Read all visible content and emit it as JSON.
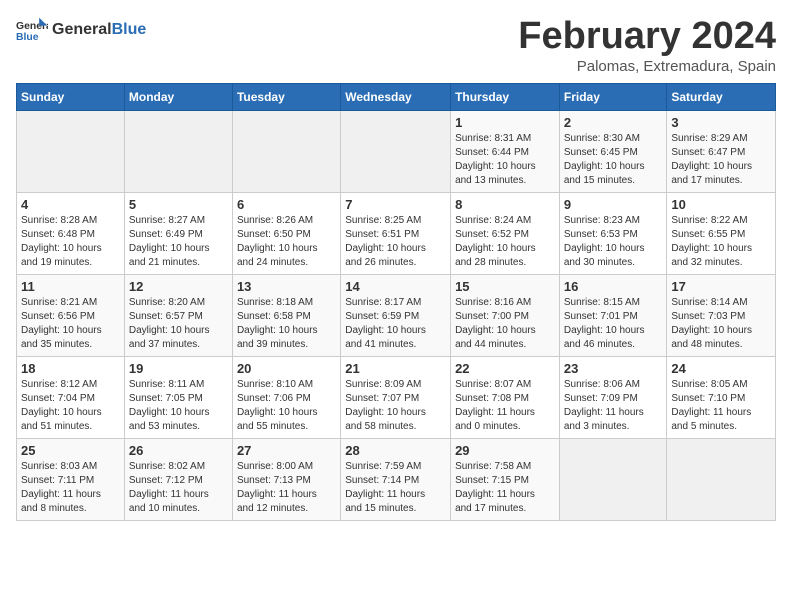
{
  "header": {
    "logo_general": "General",
    "logo_blue": "Blue",
    "month_title": "February 2024",
    "subtitle": "Palomas, Extremadura, Spain"
  },
  "days_of_week": [
    "Sunday",
    "Monday",
    "Tuesday",
    "Wednesday",
    "Thursday",
    "Friday",
    "Saturday"
  ],
  "weeks": [
    [
      {
        "num": "",
        "info": ""
      },
      {
        "num": "",
        "info": ""
      },
      {
        "num": "",
        "info": ""
      },
      {
        "num": "",
        "info": ""
      },
      {
        "num": "1",
        "info": "Sunrise: 8:31 AM\nSunset: 6:44 PM\nDaylight: 10 hours\nand 13 minutes."
      },
      {
        "num": "2",
        "info": "Sunrise: 8:30 AM\nSunset: 6:45 PM\nDaylight: 10 hours\nand 15 minutes."
      },
      {
        "num": "3",
        "info": "Sunrise: 8:29 AM\nSunset: 6:47 PM\nDaylight: 10 hours\nand 17 minutes."
      }
    ],
    [
      {
        "num": "4",
        "info": "Sunrise: 8:28 AM\nSunset: 6:48 PM\nDaylight: 10 hours\nand 19 minutes."
      },
      {
        "num": "5",
        "info": "Sunrise: 8:27 AM\nSunset: 6:49 PM\nDaylight: 10 hours\nand 21 minutes."
      },
      {
        "num": "6",
        "info": "Sunrise: 8:26 AM\nSunset: 6:50 PM\nDaylight: 10 hours\nand 24 minutes."
      },
      {
        "num": "7",
        "info": "Sunrise: 8:25 AM\nSunset: 6:51 PM\nDaylight: 10 hours\nand 26 minutes."
      },
      {
        "num": "8",
        "info": "Sunrise: 8:24 AM\nSunset: 6:52 PM\nDaylight: 10 hours\nand 28 minutes."
      },
      {
        "num": "9",
        "info": "Sunrise: 8:23 AM\nSunset: 6:53 PM\nDaylight: 10 hours\nand 30 minutes."
      },
      {
        "num": "10",
        "info": "Sunrise: 8:22 AM\nSunset: 6:55 PM\nDaylight: 10 hours\nand 32 minutes."
      }
    ],
    [
      {
        "num": "11",
        "info": "Sunrise: 8:21 AM\nSunset: 6:56 PM\nDaylight: 10 hours\nand 35 minutes."
      },
      {
        "num": "12",
        "info": "Sunrise: 8:20 AM\nSunset: 6:57 PM\nDaylight: 10 hours\nand 37 minutes."
      },
      {
        "num": "13",
        "info": "Sunrise: 8:18 AM\nSunset: 6:58 PM\nDaylight: 10 hours\nand 39 minutes."
      },
      {
        "num": "14",
        "info": "Sunrise: 8:17 AM\nSunset: 6:59 PM\nDaylight: 10 hours\nand 41 minutes."
      },
      {
        "num": "15",
        "info": "Sunrise: 8:16 AM\nSunset: 7:00 PM\nDaylight: 10 hours\nand 44 minutes."
      },
      {
        "num": "16",
        "info": "Sunrise: 8:15 AM\nSunset: 7:01 PM\nDaylight: 10 hours\nand 46 minutes."
      },
      {
        "num": "17",
        "info": "Sunrise: 8:14 AM\nSunset: 7:03 PM\nDaylight: 10 hours\nand 48 minutes."
      }
    ],
    [
      {
        "num": "18",
        "info": "Sunrise: 8:12 AM\nSunset: 7:04 PM\nDaylight: 10 hours\nand 51 minutes."
      },
      {
        "num": "19",
        "info": "Sunrise: 8:11 AM\nSunset: 7:05 PM\nDaylight: 10 hours\nand 53 minutes."
      },
      {
        "num": "20",
        "info": "Sunrise: 8:10 AM\nSunset: 7:06 PM\nDaylight: 10 hours\nand 55 minutes."
      },
      {
        "num": "21",
        "info": "Sunrise: 8:09 AM\nSunset: 7:07 PM\nDaylight: 10 hours\nand 58 minutes."
      },
      {
        "num": "22",
        "info": "Sunrise: 8:07 AM\nSunset: 7:08 PM\nDaylight: 11 hours\nand 0 minutes."
      },
      {
        "num": "23",
        "info": "Sunrise: 8:06 AM\nSunset: 7:09 PM\nDaylight: 11 hours\nand 3 minutes."
      },
      {
        "num": "24",
        "info": "Sunrise: 8:05 AM\nSunset: 7:10 PM\nDaylight: 11 hours\nand 5 minutes."
      }
    ],
    [
      {
        "num": "25",
        "info": "Sunrise: 8:03 AM\nSunset: 7:11 PM\nDaylight: 11 hours\nand 8 minutes."
      },
      {
        "num": "26",
        "info": "Sunrise: 8:02 AM\nSunset: 7:12 PM\nDaylight: 11 hours\nand 10 minutes."
      },
      {
        "num": "27",
        "info": "Sunrise: 8:00 AM\nSunset: 7:13 PM\nDaylight: 11 hours\nand 12 minutes."
      },
      {
        "num": "28",
        "info": "Sunrise: 7:59 AM\nSunset: 7:14 PM\nDaylight: 11 hours\nand 15 minutes."
      },
      {
        "num": "29",
        "info": "Sunrise: 7:58 AM\nSunset: 7:15 PM\nDaylight: 11 hours\nand 17 minutes."
      },
      {
        "num": "",
        "info": ""
      },
      {
        "num": "",
        "info": ""
      }
    ]
  ]
}
